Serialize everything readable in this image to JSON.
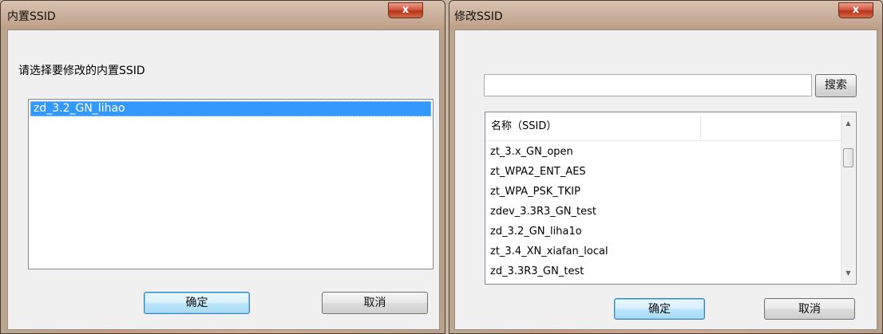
{
  "left_dialog": {
    "title": "内置SSID",
    "close_label": "x",
    "prompt": "请选择要修改的内置SSID",
    "list_items": [
      "zd_3.2_GN_lihao"
    ],
    "ok_label": "确定",
    "cancel_label": "取消"
  },
  "right_dialog": {
    "title": "修改SSID",
    "close_label": "x",
    "search": {
      "value": "",
      "button_label": "搜索"
    },
    "table": {
      "columns": [
        "名称（SSID）",
        ""
      ],
      "rows": [
        "zt_3.x_GN_open",
        "zt_WPA2_ENT_AES",
        "zt_WPA_PSK_TKIP",
        "zdev_3.3R3_GN_test",
        "zd_3.2_GN_liha1o",
        "zt_3.4_XN_xiafan_local",
        "zd_3.3R3_GN_test"
      ]
    },
    "ok_label": "确定",
    "cancel_label": "取消"
  },
  "colors": {
    "selection": "#3399ff",
    "client_bg": "#f0f0f0",
    "close_button": "#c8442b"
  },
  "icons": {
    "close": "close-icon",
    "scroll_up": "chevron-up-icon",
    "scroll_down": "chevron-down-icon"
  }
}
